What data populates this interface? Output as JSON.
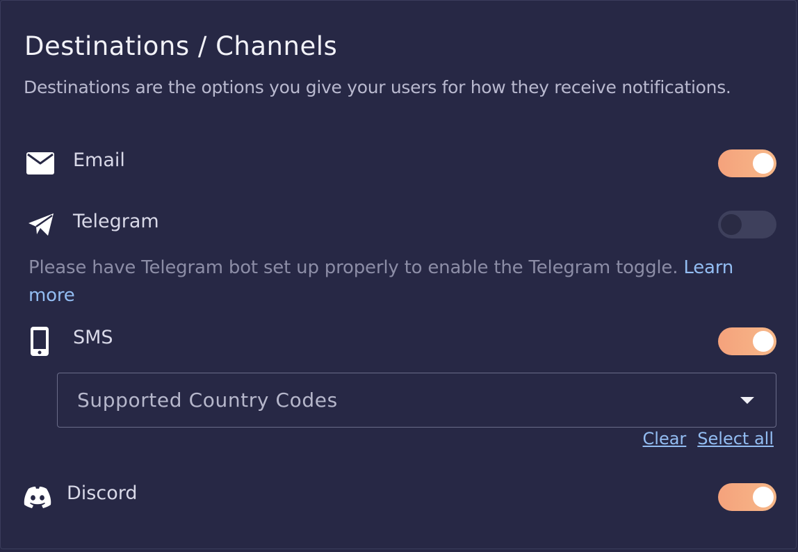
{
  "header": {
    "title": "Destinations / Channels",
    "subtitle": "Destinations are the options you give your users for how they receive notifications."
  },
  "channels": [
    {
      "label": "Email",
      "icon": "envelope-icon",
      "enabled": true
    },
    {
      "label": "Telegram",
      "icon": "paper-plane-icon",
      "enabled": false
    },
    {
      "label": "SMS",
      "icon": "mobile-phone-icon",
      "enabled": true
    },
    {
      "label": "Discord",
      "icon": "discord-icon",
      "enabled": true
    }
  ],
  "telegram_note": {
    "text": "Please have Telegram bot set up properly to enable the Telegram toggle. ",
    "link": "Learn more"
  },
  "sms": {
    "country_select_placeholder": "Supported Country Codes",
    "clear_label": "Clear",
    "select_all_label": "Select all"
  },
  "colors": {
    "background": "#272845",
    "toggle_on": "#f5a27c",
    "toggle_off": "#3e405c",
    "link": "#93bdf2"
  }
}
